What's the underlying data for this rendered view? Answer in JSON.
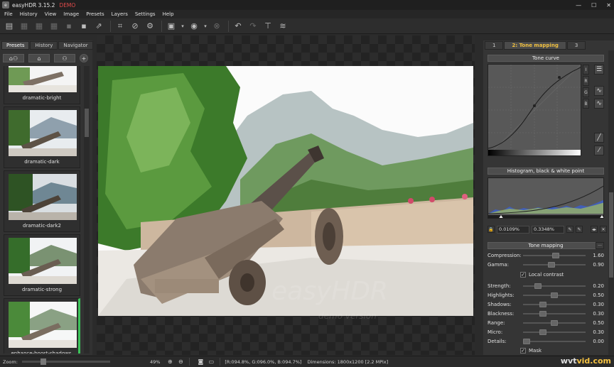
{
  "window": {
    "title": "easyHDR 3.15.2",
    "badge": "DEMO",
    "controls": [
      "—",
      "☐",
      "✕"
    ]
  },
  "menu": [
    "File",
    "History",
    "View",
    "Image",
    "Presets",
    "Layers",
    "Settings",
    "Help"
  ],
  "toolbar": {
    "icons": [
      "new-icon",
      "open-icon",
      "open-raw-icon",
      "batch-icon",
      "save-icon",
      "save-as-icon",
      "export-icon",
      "crop-icon",
      "bandage-icon",
      "settings-gear-icon",
      "image-icon",
      "dropdown-icon",
      "navigate-back-icon",
      "stop-icon",
      "undo-icon",
      "redo-icon",
      "align-icon",
      "layers-icon"
    ]
  },
  "left_panel": {
    "tabs": [
      "Presets",
      "History",
      "Navigator"
    ],
    "active_tab": "Presets",
    "presets": [
      "dramatic-bright",
      "dramatic-dark",
      "dramatic-dark2",
      "dramatic-strong",
      "enhance-boost-shadows"
    ],
    "selected_preset": "enhance-boost-shadows"
  },
  "canvas": {
    "watermark": "easyHDR",
    "watermark_sub": "demo version"
  },
  "right_panel": {
    "tabs": [
      "1",
      "2: Tone mapping",
      "3"
    ],
    "active_tab": "2: Tone mapping",
    "tone_curve": {
      "header": "Tone curve",
      "channels": [
        "I",
        "R",
        "G",
        "B"
      ]
    },
    "histogram": {
      "header": "Histogram, black & white point",
      "black_point": "0.0109%",
      "white_point": "0.3348%"
    },
    "tone_mapping": {
      "header": "Tone mapping",
      "menu_button": "···",
      "compression": {
        "label": "Compression:",
        "value": "1.60",
        "level": 0.53
      },
      "gamma": {
        "label": "Gamma:",
        "value": "0.90",
        "level": 0.45
      },
      "local_contrast": {
        "label": "Local contrast",
        "checked": true
      },
      "sliders": [
        {
          "label": "Strength:",
          "value": "0.20",
          "level": 0.2
        },
        {
          "label": "Highlights:",
          "value": "0.50",
          "level": 0.5
        },
        {
          "label": "Shadows:",
          "value": "0.30",
          "level": 0.3
        },
        {
          "label": "Blackness:",
          "value": "0.30",
          "level": 0.3
        },
        {
          "label": "Range:",
          "value": "0.50",
          "level": 0.5
        },
        {
          "label": "Micro:",
          "value": "0.30",
          "level": 0.3
        },
        {
          "label": "Details:",
          "value": "0.00",
          "level": 0.0
        }
      ],
      "mask": {
        "label": "Mask",
        "checked": true
      }
    }
  },
  "statusbar": {
    "zoom_label": "Zoom:",
    "zoom_value": "49%",
    "pixel_info": "[R:094.8%, G:096.0%, B:094.7%]",
    "dimensions": "Dimensions: 1800x1200 [2.2 MPix]"
  },
  "watermark_site": {
    "prefix": "wvt",
    "suffix": "vid.com"
  },
  "colors": {
    "accent_green": "#3cc45a",
    "tab_active": "#f0c040",
    "demo_red": "#e04a4a"
  }
}
